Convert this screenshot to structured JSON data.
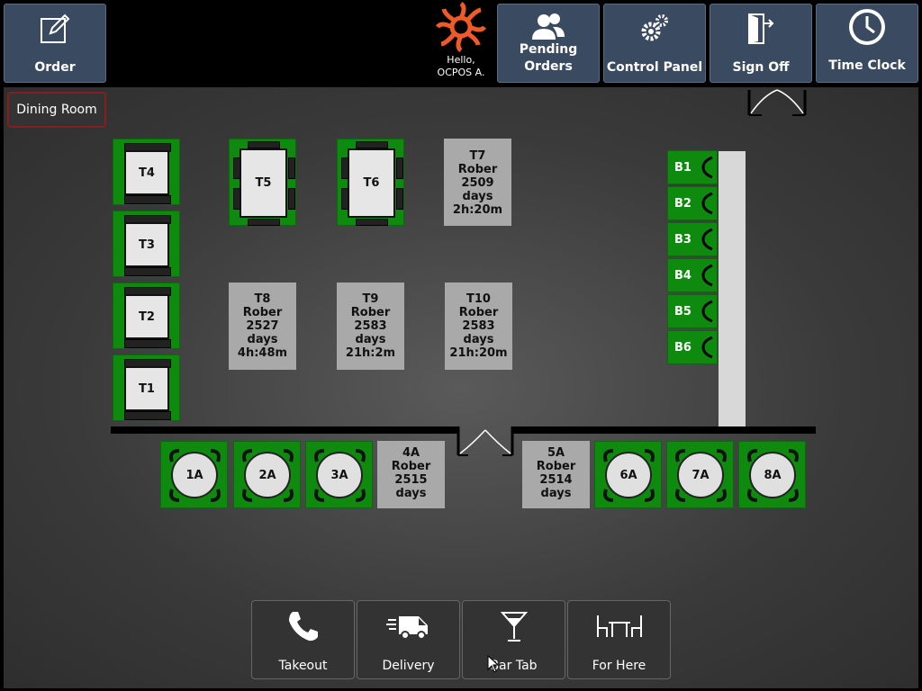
{
  "topbar": {
    "order_label": "Order",
    "pending_label": "Pending\nOrders",
    "control_label": "Control Panel",
    "signoff_label": "Sign Off",
    "timeclock_label": "Time Clock",
    "hello_text": "Hello,\nOCPOS A."
  },
  "room": {
    "label": "Dining Room"
  },
  "tables": {
    "T1": "T1",
    "T2": "T2",
    "T3": "T3",
    "T4": "T4",
    "T5": "T5",
    "T6": "T6",
    "T7": "T7\nRober\n2509\ndays\n2h:20m",
    "T8": "T8\nRober\n2527\ndays\n4h:48m",
    "T9": "T9\nRober\n2583\ndays\n21h:2m",
    "T10": "T10\nRober\n2583\ndays\n21h:20m",
    "r1A": "1A",
    "r2A": "2A",
    "r3A": "3A",
    "r4A": "4A\nRober\n2515\ndays",
    "r5A": "5A\nRober\n2514\ndays",
    "r6A": "6A",
    "r7A": "7A",
    "r8A": "8A"
  },
  "bar": {
    "B1": "B1",
    "B2": "B2",
    "B3": "B3",
    "B4": "B4",
    "B5": "B5",
    "B6": "B6"
  },
  "bottom": {
    "takeout": "Takeout",
    "delivery": "Delivery",
    "bartab": "Bar Tab",
    "forhere": "For Here"
  },
  "colors": {
    "available": "#0e8a0e",
    "occupied": "#a9a9a9",
    "button": "#3a4a60",
    "logo": "#f05a28"
  }
}
